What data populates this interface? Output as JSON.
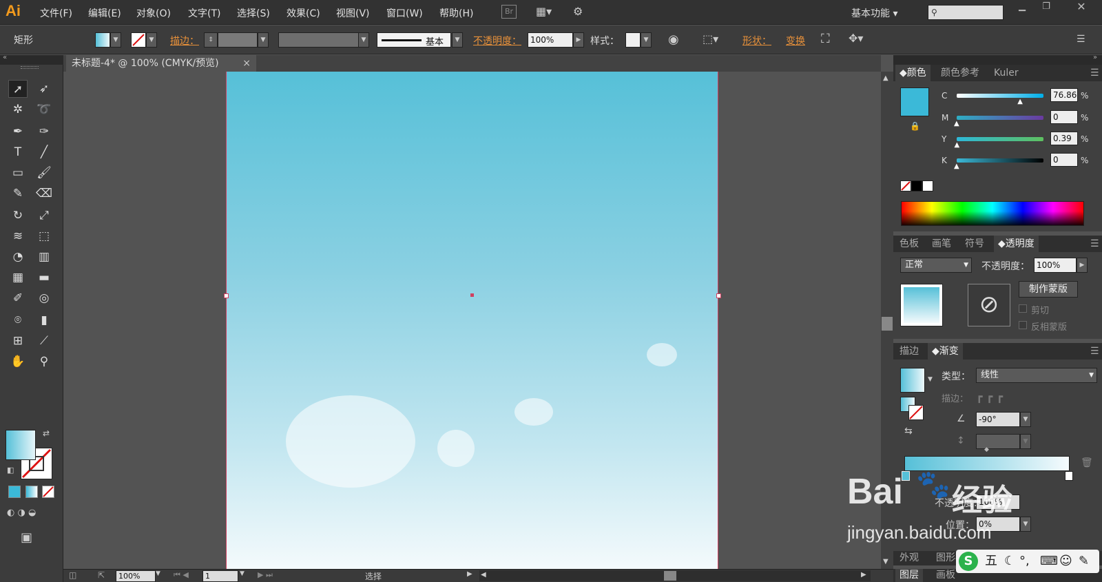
{
  "app": {
    "logo": "Ai",
    "workspace": "基本功能",
    "bridge": "Br"
  },
  "menus": [
    "文件(F)",
    "编辑(E)",
    "对象(O)",
    "文字(T)",
    "选择(S)",
    "效果(C)",
    "视图(V)",
    "窗口(W)",
    "帮助(H)"
  ],
  "control": {
    "object_type": "矩形",
    "stroke_label": "描边：",
    "stroke_profile": "基本",
    "opacity_label": "不透明度：",
    "opacity_value": "100%",
    "style_label": "样式：",
    "shape_label": "形状：",
    "transform_label": "变换"
  },
  "document": {
    "tab_title": "未标题-4* @ 100% (CMYK/预览)",
    "close": "×"
  },
  "status": {
    "zoom": "100%",
    "artboard": "1",
    "tool": "选择"
  },
  "color_panel": {
    "tabs": [
      "颜色",
      "颜色参考",
      "Kuler"
    ],
    "channels": [
      {
        "name": "C",
        "value": "76.86",
        "pct": "%",
        "level": 0.7686
      },
      {
        "name": "M",
        "value": "0",
        "pct": "%",
        "level": 0
      },
      {
        "name": "Y",
        "value": "0.39",
        "pct": "%",
        "level": 0.0039
      },
      {
        "name": "K",
        "value": "0",
        "pct": "%",
        "level": 0
      }
    ],
    "swatch_color": "#3bb9d8"
  },
  "transparency_panel": {
    "tabs": [
      "色板",
      "画笔",
      "符号",
      "透明度"
    ],
    "blend_mode": "正常",
    "opacity_label": "不透明度：",
    "opacity_value": "100%",
    "make_mask": "制作蒙版",
    "clip": "剪切",
    "invert": "反相蒙版"
  },
  "gradient_panel": {
    "tabs": [
      "描边",
      "渐变"
    ],
    "type_label": "类型：",
    "type_value": "线性",
    "stroke_label": "描边：",
    "angle": "-90°",
    "opacity_label": "不透明度：",
    "opacity_value": "100%",
    "position_label": "位置：",
    "position_value": "0%"
  },
  "bottom_tabs": [
    "外观",
    "图形样式"
  ],
  "bottom_tabs2": [
    "图层",
    "画板"
  ],
  "watermark": {
    "brand": "Bai",
    "brand2": "经验",
    "url": "jingyan.baidu.com"
  },
  "ime": {
    "label": "五"
  }
}
